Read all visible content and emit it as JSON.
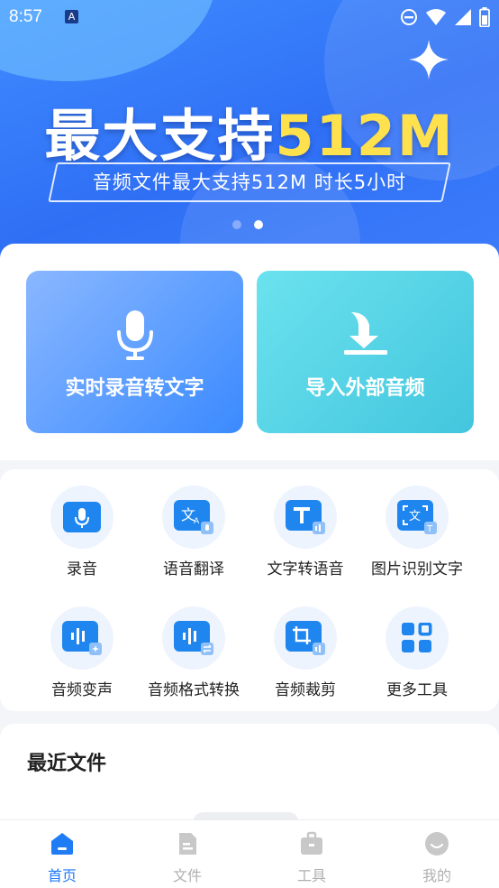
{
  "status_bar": {
    "time": "8:57",
    "notification_icon": "A"
  },
  "banner": {
    "headline_prefix": "最大支持",
    "headline_highlight": "512M",
    "subline": "音频文件最大支持512M 时长5小时",
    "carousel_total": 2,
    "carousel_active": 2,
    "highlight_color": "#ffe14d"
  },
  "actions": {
    "record_label": "实时录音转文字",
    "import_label": "导入外部音频"
  },
  "tools": [
    {
      "label": "录音",
      "icon": "microphone-icon"
    },
    {
      "label": "语音翻译",
      "icon": "translate-icon"
    },
    {
      "label": "文字转语音",
      "icon": "text-to-speech-icon"
    },
    {
      "label": "图片识别文字",
      "icon": "image-ocr-icon"
    },
    {
      "label": "音频变声",
      "icon": "voice-changer-icon"
    },
    {
      "label": "音频格式转换",
      "icon": "format-convert-icon"
    },
    {
      "label": "音频裁剪",
      "icon": "crop-icon"
    },
    {
      "label": "更多工具",
      "icon": "grid-icon"
    }
  ],
  "recent": {
    "title": "最近文件"
  },
  "bottom_nav": [
    {
      "label": "首页",
      "icon": "home-icon",
      "active": true
    },
    {
      "label": "文件",
      "icon": "file-icon",
      "active": false
    },
    {
      "label": "工具",
      "icon": "toolbox-icon",
      "active": false
    },
    {
      "label": "我的",
      "icon": "profile-icon",
      "active": false
    }
  ],
  "colors": {
    "accent": "#1f7cf5",
    "icon_blue": "#1f86f0"
  }
}
